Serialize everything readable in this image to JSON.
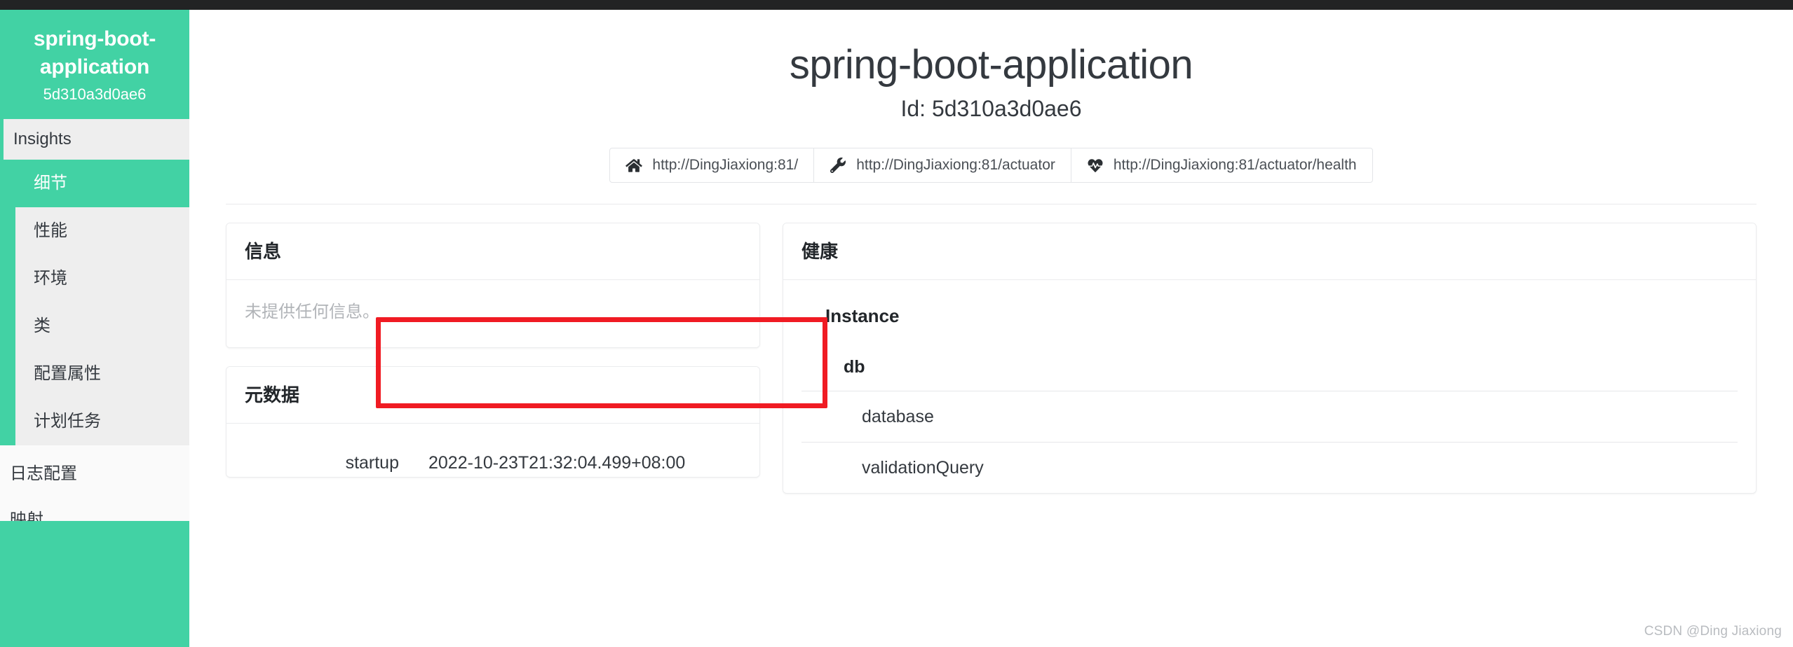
{
  "topbar": {
    "color": "#222324"
  },
  "theme": {
    "accent": "#42d2a4",
    "annotation": "#f01b23",
    "sidebar_list_bg": "#eeeeee"
  },
  "sidebar": {
    "app_name": "spring-boot-application",
    "app_id": "5d310a3d0ae6",
    "section_header": "Insights",
    "items": [
      {
        "label": "细节",
        "active": true
      },
      {
        "label": "性能",
        "active": false
      },
      {
        "label": "环境",
        "active": false
      },
      {
        "label": "类",
        "active": false
      },
      {
        "label": "配置属性",
        "active": false
      },
      {
        "label": "计划任务",
        "active": false
      }
    ],
    "top_level": [
      {
        "label": "日志配置"
      },
      {
        "label": "映射"
      }
    ]
  },
  "header": {
    "title": "spring-boot-application",
    "subtitle": "Id: 5d310a3d0ae6",
    "links": [
      {
        "icon": "home-icon",
        "label": "http://DingJiaxiong:81/"
      },
      {
        "icon": "wrench-icon",
        "label": "http://DingJiaxiong:81/actuator"
      },
      {
        "icon": "heartbeat-icon",
        "label": "http://DingJiaxiong:81/actuator/health"
      }
    ]
  },
  "info_card": {
    "title": "信息",
    "empty_text": "未提供任何信息。"
  },
  "metadata_card": {
    "title": "元数据",
    "rows": [
      {
        "key": "startup",
        "value": "2022-10-23T21:32:04.499+08:00"
      }
    ]
  },
  "health_card": {
    "title": "健康",
    "group": "Instance",
    "subgroup": "db",
    "items": [
      {
        "label": "database"
      },
      {
        "label": "validationQuery"
      }
    ]
  },
  "watermark": {
    "text": "CSDN @Ding Jiaxiong"
  }
}
